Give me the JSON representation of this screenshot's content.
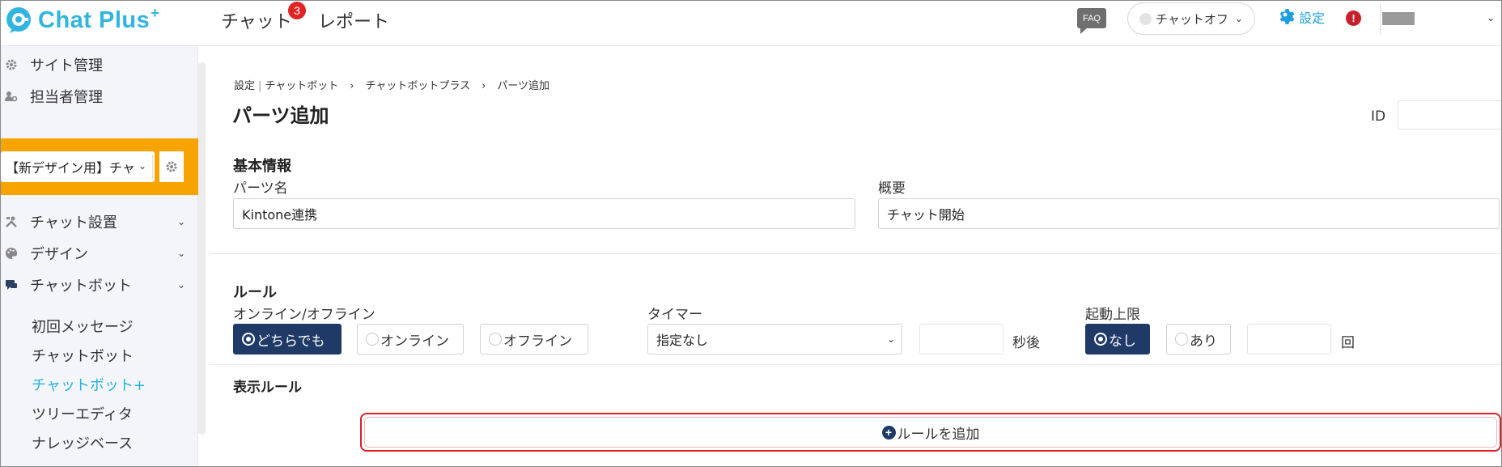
{
  "header": {
    "logo_text": "Chat Plus",
    "logo_sup": "+",
    "nav": [
      {
        "label": "チャット",
        "badge": "3"
      },
      {
        "label": "レポート"
      }
    ],
    "faq_label": "FAQ",
    "status_select": "チャットオフ",
    "settings_label": "設定",
    "alert_symbol": "!"
  },
  "sidebar": {
    "top_items": [
      {
        "label": "サイト管理",
        "icon": "gear-icon"
      },
      {
        "label": "担当者管理",
        "icon": "user-gear-icon"
      }
    ],
    "site_selector": {
      "value": "【新デザイン用】チャットプラス"
    },
    "menu_items": [
      {
        "label": "チャット設置",
        "icon": "tools-icon"
      },
      {
        "label": "デザイン",
        "icon": "palette-icon"
      },
      {
        "label": "チャットボット",
        "icon": "chat-icon"
      }
    ],
    "sub_items": [
      {
        "label": "初回メッセージ",
        "active": false
      },
      {
        "label": "チャットボット",
        "active": false
      },
      {
        "label": "チャットボット+",
        "active": true
      },
      {
        "label": "ツリーエディタ",
        "active": false
      },
      {
        "label": "ナレッジベース",
        "active": false
      }
    ]
  },
  "main": {
    "breadcrumb": [
      "設定",
      "チャットボット",
      "チャットボットプラス",
      "パーツ追加"
    ],
    "page_title": "パーツ追加",
    "id_label": "ID",
    "id_value": "",
    "basic_info": {
      "heading": "基本情報",
      "name_label": "パーツ名",
      "name_value": "Kintone連携",
      "summary_label": "概要",
      "summary_value": "チャット開始"
    },
    "rules": {
      "heading": "ルール",
      "online_label": "オンライン/オフライン",
      "online_options": [
        {
          "label": "どちらでも",
          "selected": true
        },
        {
          "label": "オンライン",
          "selected": false
        },
        {
          "label": "オフライン",
          "selected": false
        }
      ],
      "timer_label": "タイマー",
      "timer_value": "指定なし",
      "timer_seconds": "",
      "timer_unit": "秒後",
      "limit_label": "起動上限",
      "limit_options": [
        {
          "label": "なし",
          "selected": true
        },
        {
          "label": "あり",
          "selected": false
        }
      ],
      "limit_count": "",
      "limit_unit": "回"
    },
    "display_rules": {
      "heading": "表示ルール",
      "add_button": "ルールを追加"
    }
  },
  "colors": {
    "brand": "#31b5e0",
    "selected": "#1f3a66",
    "highlight_border": "#e01f26",
    "site_selector_bg": "#f7a400"
  }
}
